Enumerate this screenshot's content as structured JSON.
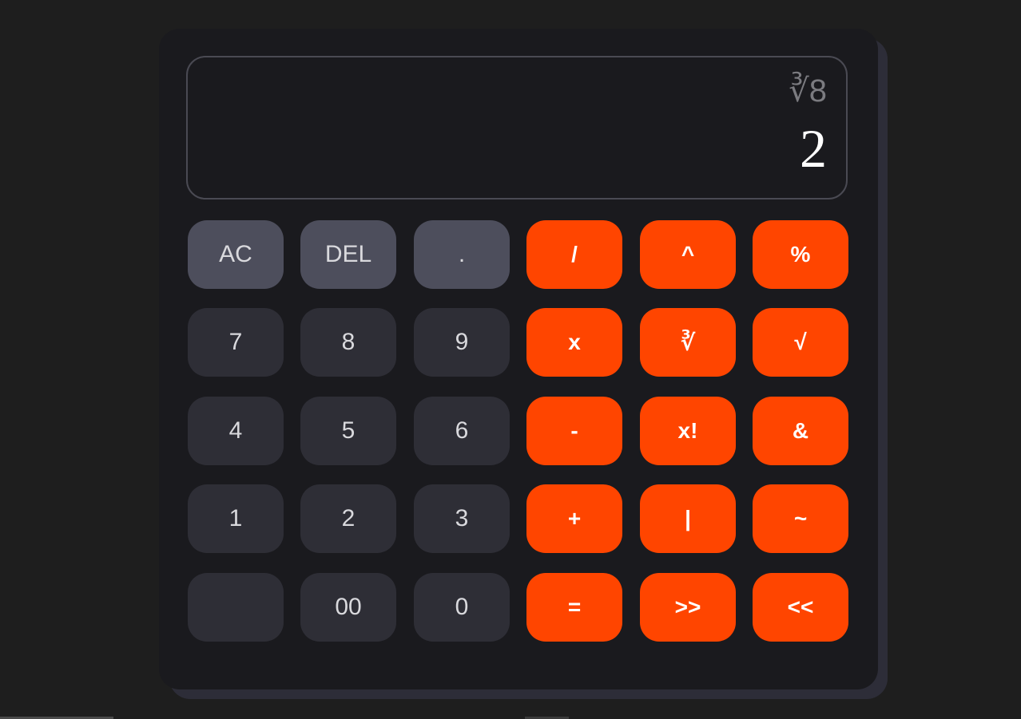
{
  "display": {
    "expression": "∛8",
    "result": "2"
  },
  "buttons": {
    "row1": [
      "AC",
      "DEL",
      ".",
      "/",
      "^",
      "%"
    ],
    "row2": [
      "7",
      "8",
      "9",
      "x",
      "∛",
      "√"
    ],
    "row3": [
      "4",
      "5",
      "6",
      "-",
      "x!",
      "&"
    ],
    "row4": [
      "1",
      "2",
      "3",
      "+",
      "|",
      "~"
    ],
    "row5": [
      "",
      "00",
      "0",
      "=",
      ">>",
      "<<"
    ]
  },
  "colors": {
    "background": "#1e1e1e",
    "calculator_body": "#1a1a1e",
    "number_key": "#2e2e36",
    "utility_key": "#4d4e5c",
    "operator_key": "#ff4500"
  }
}
